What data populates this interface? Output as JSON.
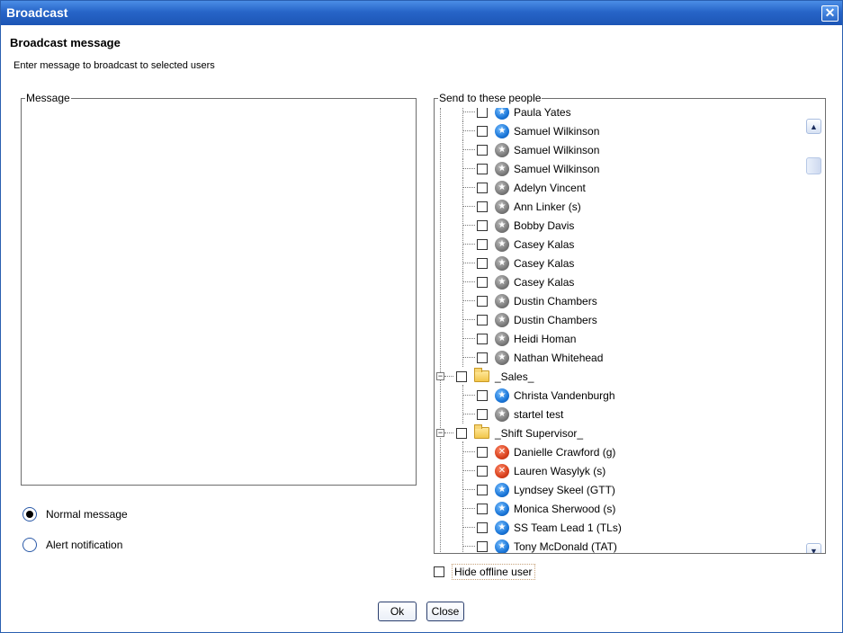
{
  "window": {
    "title": "Broadcast",
    "close_glyph": "✕"
  },
  "header": {
    "title": "Broadcast message",
    "subtitle": "Enter message to broadcast to selected users"
  },
  "message": {
    "legend": "Message",
    "value": ""
  },
  "message_type": {
    "options": [
      {
        "label": "Normal message",
        "selected": true
      },
      {
        "label": "Alert notification",
        "selected": false
      }
    ]
  },
  "recipients": {
    "legend": "Send to these people",
    "rows": [
      {
        "type": "user",
        "name": "Paula Yates",
        "status": "blue",
        "level": 2,
        "checked": false
      },
      {
        "type": "user",
        "name": "Samuel Wilkinson",
        "status": "blue",
        "level": 2,
        "checked": false
      },
      {
        "type": "user",
        "name": "Samuel Wilkinson",
        "status": "gray",
        "level": 2,
        "checked": false
      },
      {
        "type": "user",
        "name": "Samuel Wilkinson",
        "status": "gray",
        "level": 2,
        "checked": false
      },
      {
        "type": "user",
        "name": "Adelyn Vincent",
        "status": "gray",
        "level": 2,
        "checked": false
      },
      {
        "type": "user",
        "name": "Ann Linker (s)",
        "status": "gray",
        "level": 2,
        "checked": false
      },
      {
        "type": "user",
        "name": "Bobby Davis",
        "status": "gray",
        "level": 2,
        "checked": false
      },
      {
        "type": "user",
        "name": "Casey Kalas",
        "status": "gray",
        "level": 2,
        "checked": false
      },
      {
        "type": "user",
        "name": "Casey Kalas",
        "status": "gray",
        "level": 2,
        "checked": false
      },
      {
        "type": "user",
        "name": "Casey Kalas",
        "status": "gray",
        "level": 2,
        "checked": false
      },
      {
        "type": "user",
        "name": "Dustin Chambers",
        "status": "gray",
        "level": 2,
        "checked": false
      },
      {
        "type": "user",
        "name": "Dustin Chambers",
        "status": "gray",
        "level": 2,
        "checked": false
      },
      {
        "type": "user",
        "name": "Heidi Homan",
        "status": "gray",
        "level": 2,
        "checked": false
      },
      {
        "type": "user",
        "name": "Nathan Whitehead",
        "status": "gray",
        "level": 2,
        "checked": false
      },
      {
        "type": "group",
        "name": "_Sales_",
        "level": 1,
        "checked": false,
        "expander": "−"
      },
      {
        "type": "user",
        "name": "Christa Vandenburgh",
        "status": "blue",
        "level": 2,
        "checked": false
      },
      {
        "type": "user",
        "name": "startel test",
        "status": "gray",
        "level": 2,
        "checked": false
      },
      {
        "type": "group",
        "name": "_Shift Supervisor_",
        "level": 1,
        "checked": false,
        "expander": "−"
      },
      {
        "type": "user",
        "name": "Danielle Crawford (g)",
        "status": "red",
        "level": 2,
        "checked": false
      },
      {
        "type": "user",
        "name": "Lauren Wasylyk (s)",
        "status": "red",
        "level": 2,
        "checked": false
      },
      {
        "type": "user",
        "name": "Lyndsey Skeel (GTT)",
        "status": "blue",
        "level": 2,
        "checked": false
      },
      {
        "type": "user",
        "name": "Monica Sherwood (s)",
        "status": "blue",
        "level": 2,
        "checked": false
      },
      {
        "type": "user",
        "name": "SS Team Lead 1 (TLs)",
        "status": "blue",
        "level": 2,
        "checked": false
      },
      {
        "type": "user",
        "name": "Tony McDonald (TAT)",
        "status": "blue",
        "level": 2,
        "checked": false
      }
    ],
    "scroll_up_glyph": "▲",
    "scroll_down_glyph": "▼"
  },
  "hide_offline": {
    "label": "Hide offline user",
    "checked": false
  },
  "buttons": {
    "ok": "Ok",
    "close": "Close"
  },
  "icons": {
    "status_blue": "#1a76d8",
    "status_gray": "#7a7a7a",
    "status_red": "#d8401c"
  }
}
